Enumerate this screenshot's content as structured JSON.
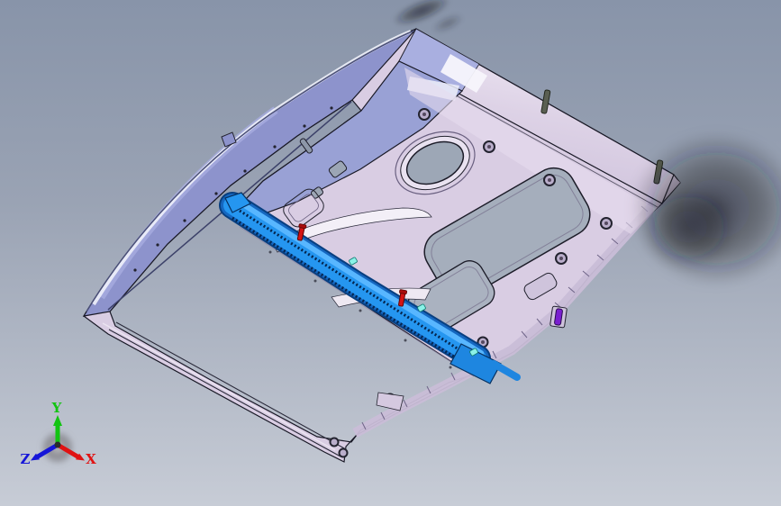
{
  "viewer": {
    "type": "3d-cad-viewport",
    "background": {
      "gradient_top": "#8894a9",
      "gradient_bottom": "#c7ccd6"
    },
    "model": {
      "name": "car-door-inner-panel-assembly",
      "view": "isometric",
      "parts": [
        {
          "name": "door-frame-rail",
          "color": "#8d93cc"
        },
        {
          "name": "inner-door-panel",
          "color": "#d9cde3"
        },
        {
          "name": "upper-reinforcement-panel",
          "color": "#99a1d5"
        },
        {
          "name": "window-regulator-rail",
          "color": "#2596f0",
          "state": "highlighted"
        },
        {
          "name": "fastener-screws",
          "color": "#d41414"
        },
        {
          "name": "door-edge-clip",
          "color": "#7a1fd0"
        },
        {
          "name": "snap-clips",
          "color": "#8af2e8"
        }
      ],
      "features": [
        "window-opening",
        "speaker-hole",
        "access-holes",
        "bolt-holes",
        "locating-pins"
      ]
    },
    "triad": {
      "axes": [
        {
          "label": "Y",
          "color": "#12c412",
          "direction": "up"
        },
        {
          "label": "Z",
          "color": "#1515d8",
          "direction": "lower-left"
        },
        {
          "label": "X",
          "color": "#e01212",
          "direction": "lower-right"
        }
      ]
    }
  }
}
